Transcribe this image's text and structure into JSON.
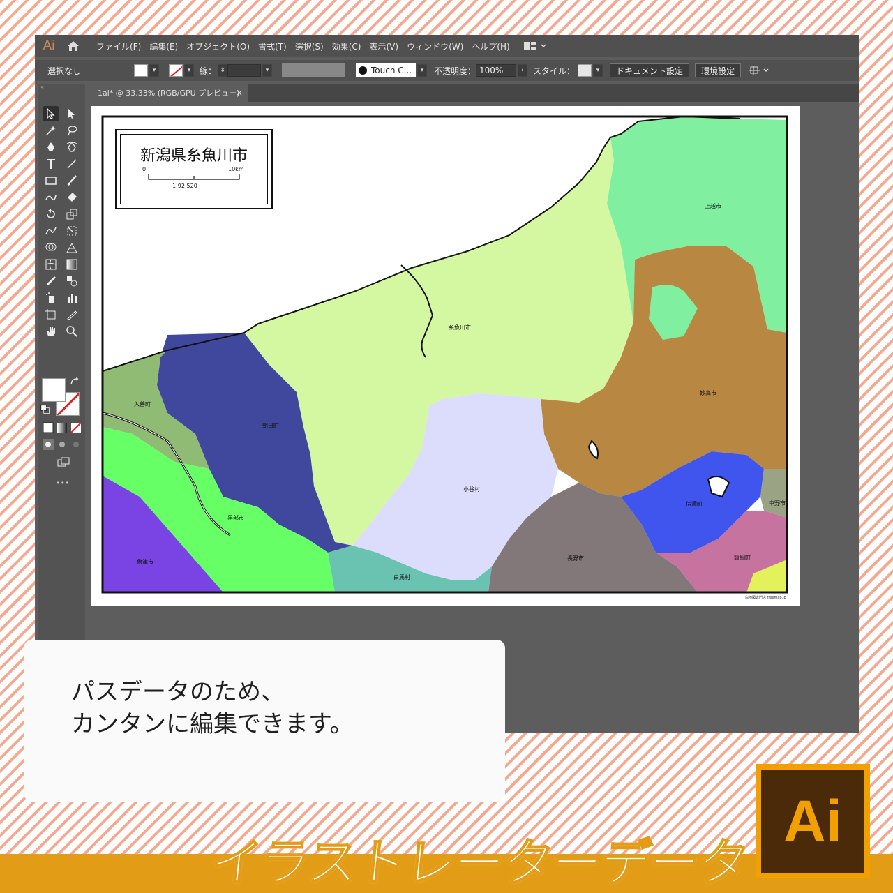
{
  "app": {
    "logo": "Ai",
    "menus": [
      "ファイル(F)",
      "編集(E)",
      "オブジェクト(O)",
      "書式(T)",
      "選択(S)",
      "効果(C)",
      "表示(V)",
      "ウィンドウ(W)",
      "ヘルプ(H)"
    ]
  },
  "control": {
    "selection": "選択なし",
    "stroke_label": "線：",
    "brush": "Touch C...",
    "opacity_label": "不透明度：",
    "opacity": "100%",
    "style_label": "スタイル：",
    "doc_setup": "ドキュメント設定",
    "prefs": "環境設定"
  },
  "tab": {
    "title": "1ai* @ 33.33% (RGB/GPU プレビュー)",
    "close": "×"
  },
  "toolbar": {
    "more": "•••"
  },
  "map": {
    "title": "新潟県糸魚川市",
    "scale_start": "0",
    "scale_end": "10km",
    "scale_ratio": "1:92,520",
    "regions": {
      "joetsu": "上越市",
      "itoigawa": "糸魚川市",
      "myoko": "妙高市",
      "nyuzen": "入善町",
      "asahi": "朝日町",
      "otari": "小谷村",
      "kurobe": "黒部市",
      "shinano": "信濃町",
      "nakano": "中野市",
      "uozu": "魚津市",
      "nagano": "長野市",
      "iizuna": "飯綱町",
      "hakuba": "白馬村"
    },
    "credit": "白地図専門店 freemap.jp"
  },
  "caption": {
    "line1": "パスデータのため、",
    "line2": "カンタンに編集できます。"
  },
  "footer": {
    "title": "イラストレーターデータ",
    "badge": "Ai"
  },
  "colors": {
    "joetsu": "#80f0a0",
    "itoigawa": "#d4f7a2",
    "myoko": "#b88742",
    "nyuzen": "#8fbb74",
    "asahi": "#3f489c",
    "otari": "#dcdcfc",
    "kurobe": "#66ff66",
    "shinano": "#4055ee",
    "nakano": "#9aa384",
    "uozu": "#7a43e4",
    "nagano": "#837879",
    "iizuna": "#c7739f",
    "hakuba": "#6ac2b0",
    "footer": "#e29c15"
  }
}
